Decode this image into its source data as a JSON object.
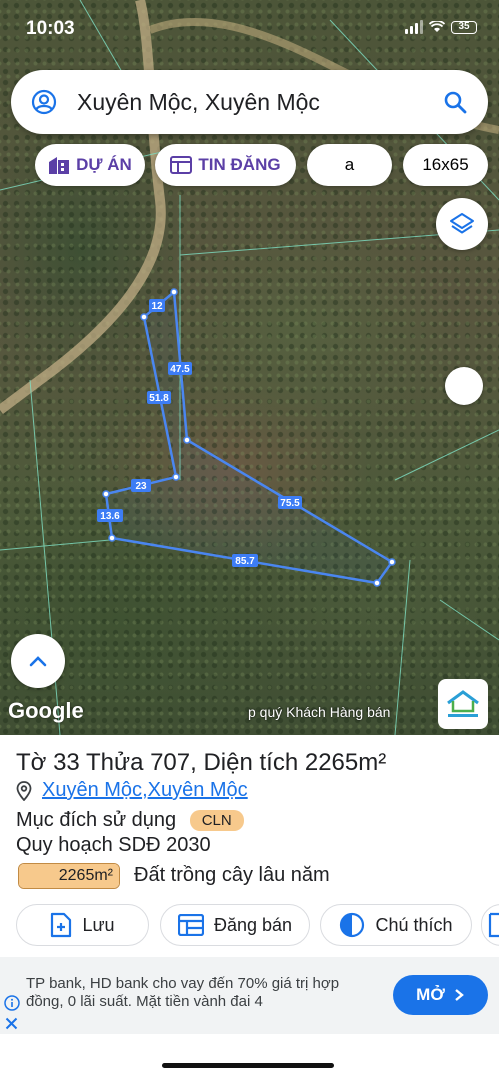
{
  "status_bar": {
    "time": "10:03",
    "battery": "35"
  },
  "search": {
    "query": "Xuyên Mộc, Xuyên Mộc"
  },
  "chips": [
    {
      "label": "DỰ ÁN"
    },
    {
      "label": "TIN ĐĂNG"
    },
    {
      "label": "a"
    },
    {
      "label": "16x65"
    }
  ],
  "map": {
    "parcel_edges": [
      "12",
      "47.5",
      "51.8",
      "75.5",
      "23",
      "13.6",
      "85.7"
    ],
    "google_label": "Google",
    "attribution": "p quý Khách Hàng bán"
  },
  "parcel": {
    "title": "Tờ 33 Thửa 707, Diện tích 2265m²",
    "location_parts": [
      "Xuyên Mộc",
      ", ",
      "Xuyên Mộc"
    ],
    "purpose_label": "Mục đích sử dụng",
    "purpose_code": "CLN",
    "plan_label": "Quy hoạch SDĐ 2030",
    "plan_area": "2265m²",
    "plan_fraction": 1.0,
    "land_type": "Đất trồng cây lâu năm"
  },
  "actions": [
    {
      "label": "Lưu"
    },
    {
      "label": "Đăng bán"
    },
    {
      "label": "Chú thích"
    }
  ],
  "ad": {
    "text": "TP bank, HD bank cho vay đến 70% giá trị hợp đồng, 0 lãi suất. Mặt tiền vành đai 4",
    "button": "MỞ"
  },
  "colors": {
    "accent": "#1a73e8",
    "chip_purple": "#5b3fa6",
    "parcel_line": "#3d7df5",
    "badge": "#f7c98c"
  }
}
